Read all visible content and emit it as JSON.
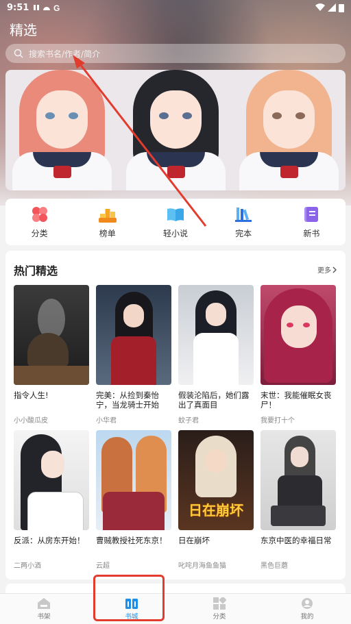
{
  "status": {
    "time": "9:51"
  },
  "header": {
    "title": "精选",
    "search_placeholder": "搜索书名/作者/简介"
  },
  "categories": [
    {
      "label": "分类",
      "icon": "four-petal-icon",
      "color": "#f2555a"
    },
    {
      "label": "榜单",
      "icon": "ranking-icon",
      "color": "#f6a623"
    },
    {
      "label": "轻小说",
      "icon": "open-book-icon",
      "color": "#3aa8e8"
    },
    {
      "label": "完本",
      "icon": "books-shelf-icon",
      "color": "#2e6fe0"
    },
    {
      "label": "新书",
      "icon": "new-book-icon",
      "color": "#8a63e8"
    }
  ],
  "hot": {
    "title": "热门精选",
    "more_label": "更多",
    "books": [
      {
        "name": "指令人生!",
        "author": "小小酸瓜皮"
      },
      {
        "name": "完美：从捡到秦怡宁，当龙骑士开始",
        "author": "小华君"
      },
      {
        "name": "假装沦陷后，她们露出了真面目",
        "author": "蚊子君"
      },
      {
        "name": "末世：我能催眠女丧尸！",
        "author": "我要打十个"
      },
      {
        "name": "反派：从房东开始！",
        "author": "二两小酒"
      },
      {
        "name": "曹贼教授社死东京！",
        "author": "云超"
      },
      {
        "name": "日在崩坏",
        "author": "叱咤月海鱼鱼猫"
      },
      {
        "name": "东京中医的幸福日常",
        "author": "黑色巨蘑"
      }
    ],
    "cover_overlay_text": "日在崩坏"
  },
  "tabs": [
    {
      "label": "书架",
      "icon": "house-icon"
    },
    {
      "label": "书城",
      "icon": "book-city-icon"
    },
    {
      "label": "分类",
      "icon": "grid-icon"
    },
    {
      "label": "我的",
      "icon": "profile-icon"
    }
  ],
  "colors": {
    "accent": "#1e8fe8",
    "annotation": "#e23c2e"
  }
}
